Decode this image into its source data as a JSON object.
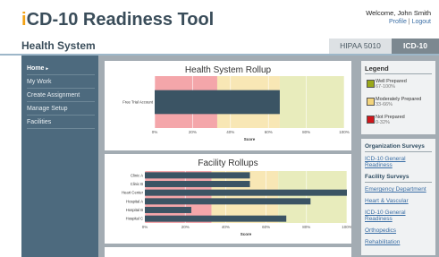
{
  "header": {
    "title_prefix": "i",
    "title_rest": "CD-10 Readiness Tool",
    "welcome": "Welcome, John Smith",
    "profile_link": "Profile",
    "separator": "|",
    "logout_link": "Logout"
  },
  "section": {
    "title": "Health System"
  },
  "tabs": [
    {
      "label": "HIPAA 5010",
      "active": false
    },
    {
      "label": "ICD-10",
      "active": true
    }
  ],
  "sidebar": {
    "items": [
      {
        "label": "Home",
        "active": true,
        "caret": "▸"
      },
      {
        "label": "My Work",
        "active": false
      },
      {
        "label": "Create Assignment",
        "active": false
      },
      {
        "label": "Manage Setup",
        "active": false
      },
      {
        "label": "Facilities",
        "active": false
      }
    ]
  },
  "legend": {
    "title": "Legend",
    "items": [
      {
        "label": "Well Prepared",
        "range": "67-100%",
        "color": "#9aa81a"
      },
      {
        "label": "Moderately Prepared",
        "range": "33-66%",
        "color": "#f3d47c"
      },
      {
        "label": "Not Prepared",
        "range": "0-32%",
        "color": "#d0161b"
      }
    ]
  },
  "surveys": {
    "org_heading": "Organization Surveys",
    "org_links": [
      "ICD-10 General Readiness"
    ],
    "facility_heading": "Facility Surveys",
    "facility_links": [
      "Emergency Department",
      "Heart & Vascular",
      "ICD-10 General Readiness",
      "Orthopedics",
      "Rehabilitation"
    ]
  },
  "chart_data": [
    {
      "type": "bar",
      "orientation": "horizontal",
      "title": "Health System Rollup",
      "xlabel": "Score",
      "xlim": [
        0,
        100
      ],
      "ticks": [
        "0%",
        "20%",
        "40%",
        "60%",
        "80%",
        "100%"
      ],
      "categories": [
        "Free Trial Account"
      ],
      "values": [
        66
      ],
      "bar_color": "#3b5464",
      "bands": [
        {
          "from": 0,
          "to": 33,
          "color": "#f4a6aa"
        },
        {
          "from": 33,
          "to": 66,
          "color": "#f8e7b5"
        },
        {
          "from": 66,
          "to": 100,
          "color": "#e8ecbc"
        }
      ]
    },
    {
      "type": "bar",
      "orientation": "horizontal",
      "title": "Facility Rollups",
      "xlabel": "Score",
      "xlim": [
        0,
        100
      ],
      "ticks": [
        "0%",
        "20%",
        "40%",
        "60%",
        "80%",
        "100%"
      ],
      "categories": [
        "Clinic A",
        "Clinic B",
        "Heart Center",
        "Hospital A",
        "Hospital B",
        "Hospital C"
      ],
      "values": [
        52,
        52,
        100,
        82,
        23,
        70
      ],
      "bar_color": "#3b5464",
      "bands": [
        {
          "from": 0,
          "to": 33,
          "color": "#f4a6aa"
        },
        {
          "from": 33,
          "to": 66,
          "color": "#f8e7b5"
        },
        {
          "from": 66,
          "to": 100,
          "color": "#e8ecbc"
        }
      ]
    }
  ]
}
